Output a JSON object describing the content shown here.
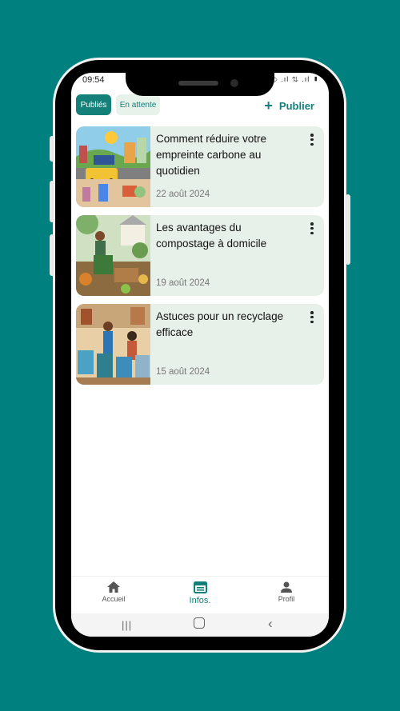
{
  "status_bar": {
    "time": "09:54",
    "icons_right": "⬦ .ıl ⇅ .ıl ▮"
  },
  "filters": {
    "published": "Publiés",
    "pending": "En attente"
  },
  "publish_button": {
    "label": "Publier"
  },
  "articles": [
    {
      "title": "Comment réduire votre empreinte carbone au quotidien",
      "date": "22 août 2024",
      "image": "eco-city-illustration"
    },
    {
      "title": "Les avantages du compostage à domicile",
      "date": "19 août 2024",
      "image": "composting-illustration"
    },
    {
      "title": "Astuces pour un recyclage efficace",
      "date": "15 août 2024",
      "image": "recycling-illustration"
    }
  ],
  "bottom_nav": [
    {
      "label": "Accueil",
      "icon": "home-icon"
    },
    {
      "label": "Infos.",
      "icon": "news-icon",
      "active": true
    },
    {
      "label": "Profil",
      "icon": "person-icon"
    }
  ],
  "colors": {
    "background": "#00807f",
    "accent": "#13807a",
    "card": "#e8f1e9"
  }
}
